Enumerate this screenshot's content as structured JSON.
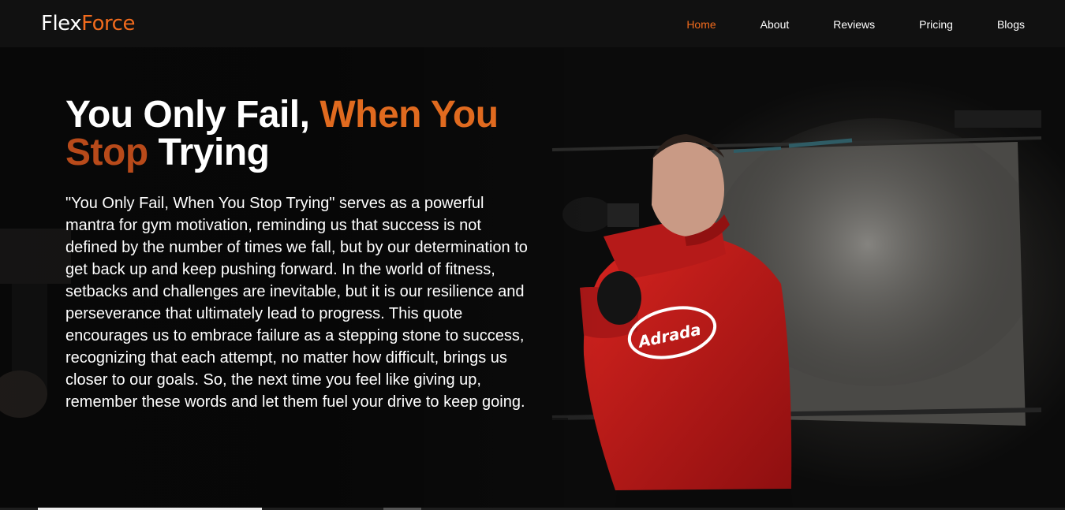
{
  "navbar": {
    "logo": {
      "part1": "Flex",
      "part2": "Force"
    },
    "items": [
      {
        "label": "Home",
        "active": true
      },
      {
        "label": "About",
        "active": false
      },
      {
        "label": "Reviews",
        "active": false
      },
      {
        "label": "Pricing",
        "active": false
      },
      {
        "label": "Blogs",
        "active": false
      }
    ]
  },
  "hero": {
    "title": {
      "part1": "You Only Fail, ",
      "part2": "When You",
      "part3": "Stop",
      "part4": " Trying"
    },
    "text": "\"You Only Fail, When You Stop Trying\" serves as a powerful mantra for gym motivation, reminding us that success is not defined by the number of times we fall, but by our determination to get back up and keep pushing forward. In the world of fitness, setbacks and challenges are inevitable, but it is our resilience and perseverance that ultimately lead to progress. This quote encourages us to embrace failure as a stepping stone to success, recognizing that each attempt, no matter how difficult, brings us closer to our goals. So, the next time you feel like giving up, remember these words and let them fuel your drive to keep going.",
    "jersey_text": "Adrada"
  },
  "slider": {
    "progress": 0.21
  },
  "colors": {
    "accent": "#f26b1d",
    "title_accent": "#e06a1f",
    "title_accent_dark": "#b84a1a",
    "nav_bg": "#111111",
    "hoodie": "#c41818"
  }
}
